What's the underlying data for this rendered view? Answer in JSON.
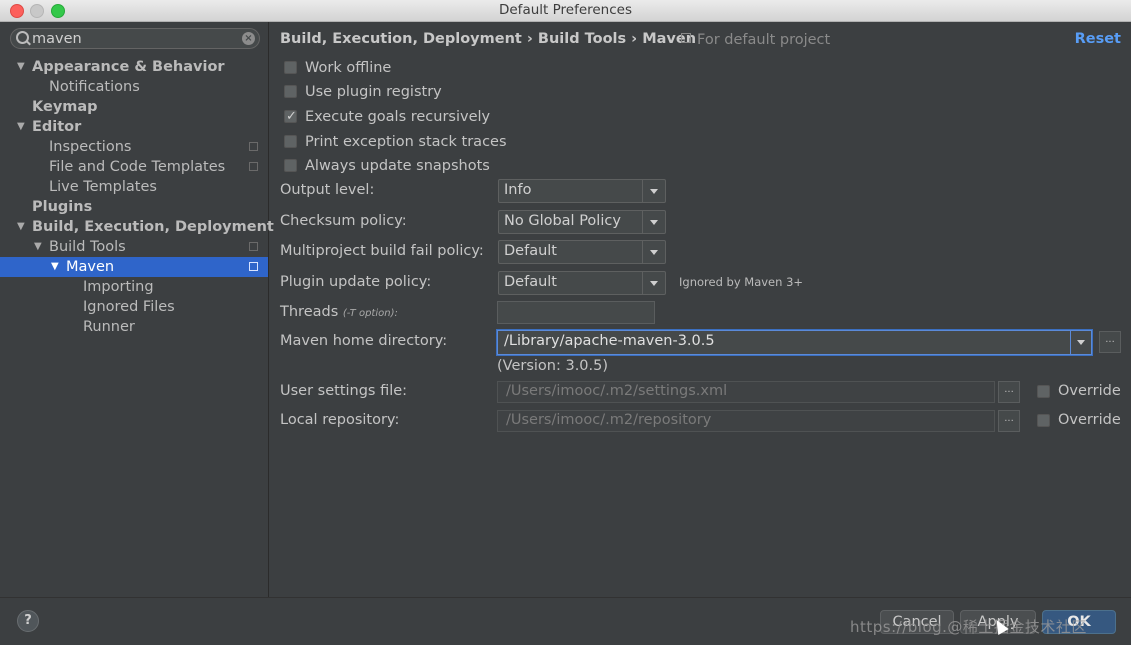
{
  "window": {
    "title": "Default Preferences"
  },
  "search": {
    "value": "maven"
  },
  "tree": [
    {
      "label": "Appearance & Behavior",
      "bold": true,
      "expanded": true,
      "depth": 0
    },
    {
      "label": "Notifications",
      "bold": false,
      "depth": 1
    },
    {
      "label": "Keymap",
      "bold": true,
      "depth": 0
    },
    {
      "label": "Editor",
      "bold": true,
      "expanded": true,
      "depth": 0
    },
    {
      "label": "Inspections",
      "bold": false,
      "depth": 1,
      "project_icon": true
    },
    {
      "label": "File and Code Templates",
      "bold": false,
      "depth": 1,
      "project_icon": true
    },
    {
      "label": "Live Templates",
      "bold": false,
      "depth": 1
    },
    {
      "label": "Plugins",
      "bold": true,
      "depth": 0
    },
    {
      "label": "Build, Execution, Deployment",
      "bold": true,
      "expanded": true,
      "depth": 0
    },
    {
      "label": "Build Tools",
      "bold": false,
      "expanded": true,
      "depth": 1,
      "project_icon": true
    },
    {
      "label": "Maven",
      "bold": false,
      "expanded": true,
      "depth": 2,
      "selected": true,
      "project_icon": true
    },
    {
      "label": "Importing",
      "bold": false,
      "depth": 3
    },
    {
      "label": "Ignored Files",
      "bold": false,
      "depth": 3
    },
    {
      "label": "Runner",
      "bold": false,
      "depth": 3
    }
  ],
  "breadcrumb": {
    "path": "Build, Execution, Deployment › Build Tools › Maven",
    "scope": "For default project"
  },
  "reset_label": "Reset",
  "checkboxes": [
    {
      "label": "Work offline",
      "checked": false
    },
    {
      "label": "Use plugin registry",
      "checked": false
    },
    {
      "label": "Execute goals recursively",
      "checked": true
    },
    {
      "label": "Print exception stack traces",
      "checked": false
    },
    {
      "label": "Always update snapshots",
      "checked": false
    }
  ],
  "fields": {
    "output_level": {
      "label": "Output level:",
      "value": "Info"
    },
    "checksum_policy": {
      "label": "Checksum policy:",
      "value": "No Global Policy"
    },
    "multiproject_policy": {
      "label": "Multiproject build fail policy:",
      "value": "Default"
    },
    "plugin_update_policy": {
      "label": "Plugin update policy:",
      "value": "Default",
      "note": "Ignored by Maven 3+"
    },
    "threads": {
      "label": "Threads",
      "hint": "(-T option):",
      "value": ""
    },
    "maven_home": {
      "label": "Maven home directory:",
      "value": "/Library/apache-maven-3.0.5",
      "version": "(Version: 3.0.5)"
    },
    "user_settings": {
      "label": "User settings file:",
      "value": "/Users/imooc/.m2/settings.xml",
      "override_label": "Override",
      "override_checked": false
    },
    "local_repo": {
      "label": "Local repository:",
      "value": "/Users/imooc/.m2/repository",
      "override_label": "Override",
      "override_checked": false
    }
  },
  "browse_label": "...",
  "footer": {
    "help": "?",
    "cancel": "Cancel",
    "apply": "Apply",
    "ok": "OK",
    "watermark": "https://blog.@稀土掘金技术社区"
  },
  "colors": {
    "selection": "#2f65ca",
    "link": "#589df6",
    "background": "#3c3f41"
  }
}
